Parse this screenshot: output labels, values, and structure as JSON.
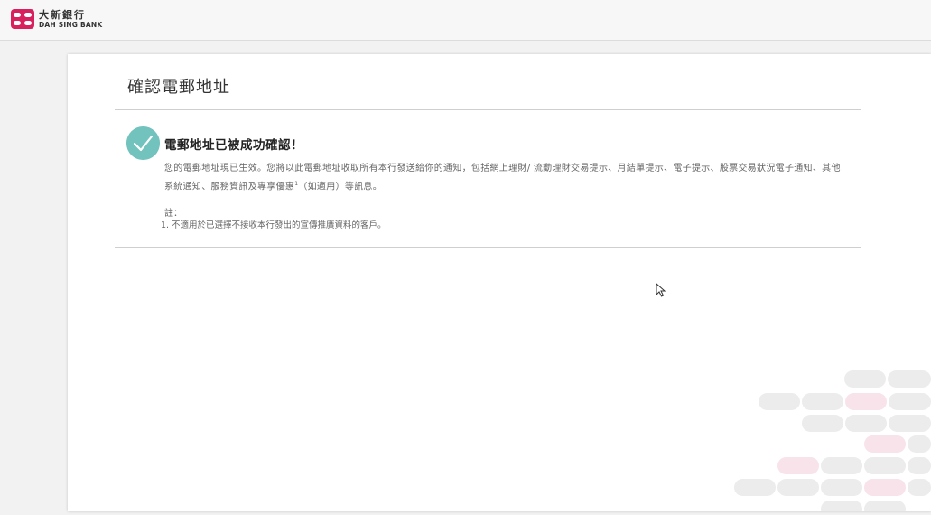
{
  "header": {
    "logo_zh": "大新銀行",
    "logo_en": "DAH SING BANK",
    "brand_color": "#d8205f"
  },
  "main": {
    "title": "確認電郵地址",
    "success": {
      "icon": "check-circle-icon",
      "icon_color": "#72c3bd",
      "heading": "電郵地址已被成功確認！",
      "message_part1": "您的電郵地址現已生效。您將以此電郵地址收取所有本行發送給你的通知，包括網上理財/ 流動理財交易提示、月結單提示、電子提示、股票交易狀況電子通知、其他系統通知、服務資訊及專享優惠",
      "message_sup": "1",
      "message_part2": "（如適用）等訊息。"
    },
    "notes": {
      "label": "註：",
      "items": [
        {
          "num": "1.",
          "text": "不適用於已選擇不接收本行發出的宣傳推廣資料的客戶。"
        }
      ]
    }
  }
}
